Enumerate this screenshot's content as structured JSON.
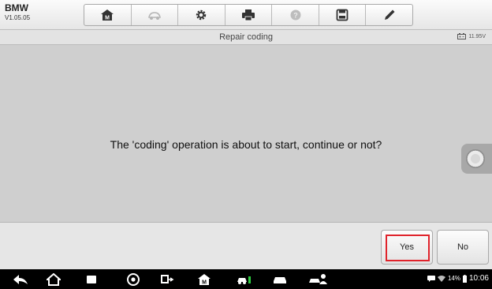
{
  "brand": {
    "name": "BMW",
    "version": "V1.05.05"
  },
  "toolbar": {
    "items": [
      {
        "icon": "home-icon"
      },
      {
        "icon": "vehicle-swap-icon"
      },
      {
        "icon": "settings-gear-icon"
      },
      {
        "icon": "print-icon"
      },
      {
        "icon": "help-icon"
      },
      {
        "icon": "save-icon"
      },
      {
        "icon": "edit-pen-icon"
      }
    ]
  },
  "title_bar": {
    "title": "Repair coding",
    "battery_voltage": "11.95V"
  },
  "dialog": {
    "message": "The 'coding' operation is about to start, continue or not?"
  },
  "actions": {
    "yes_label": "Yes",
    "no_label": "No"
  },
  "colors": {
    "highlight": "#e0232b"
  },
  "status_bar": {
    "battery_percent": "14%",
    "time": "10:06"
  }
}
